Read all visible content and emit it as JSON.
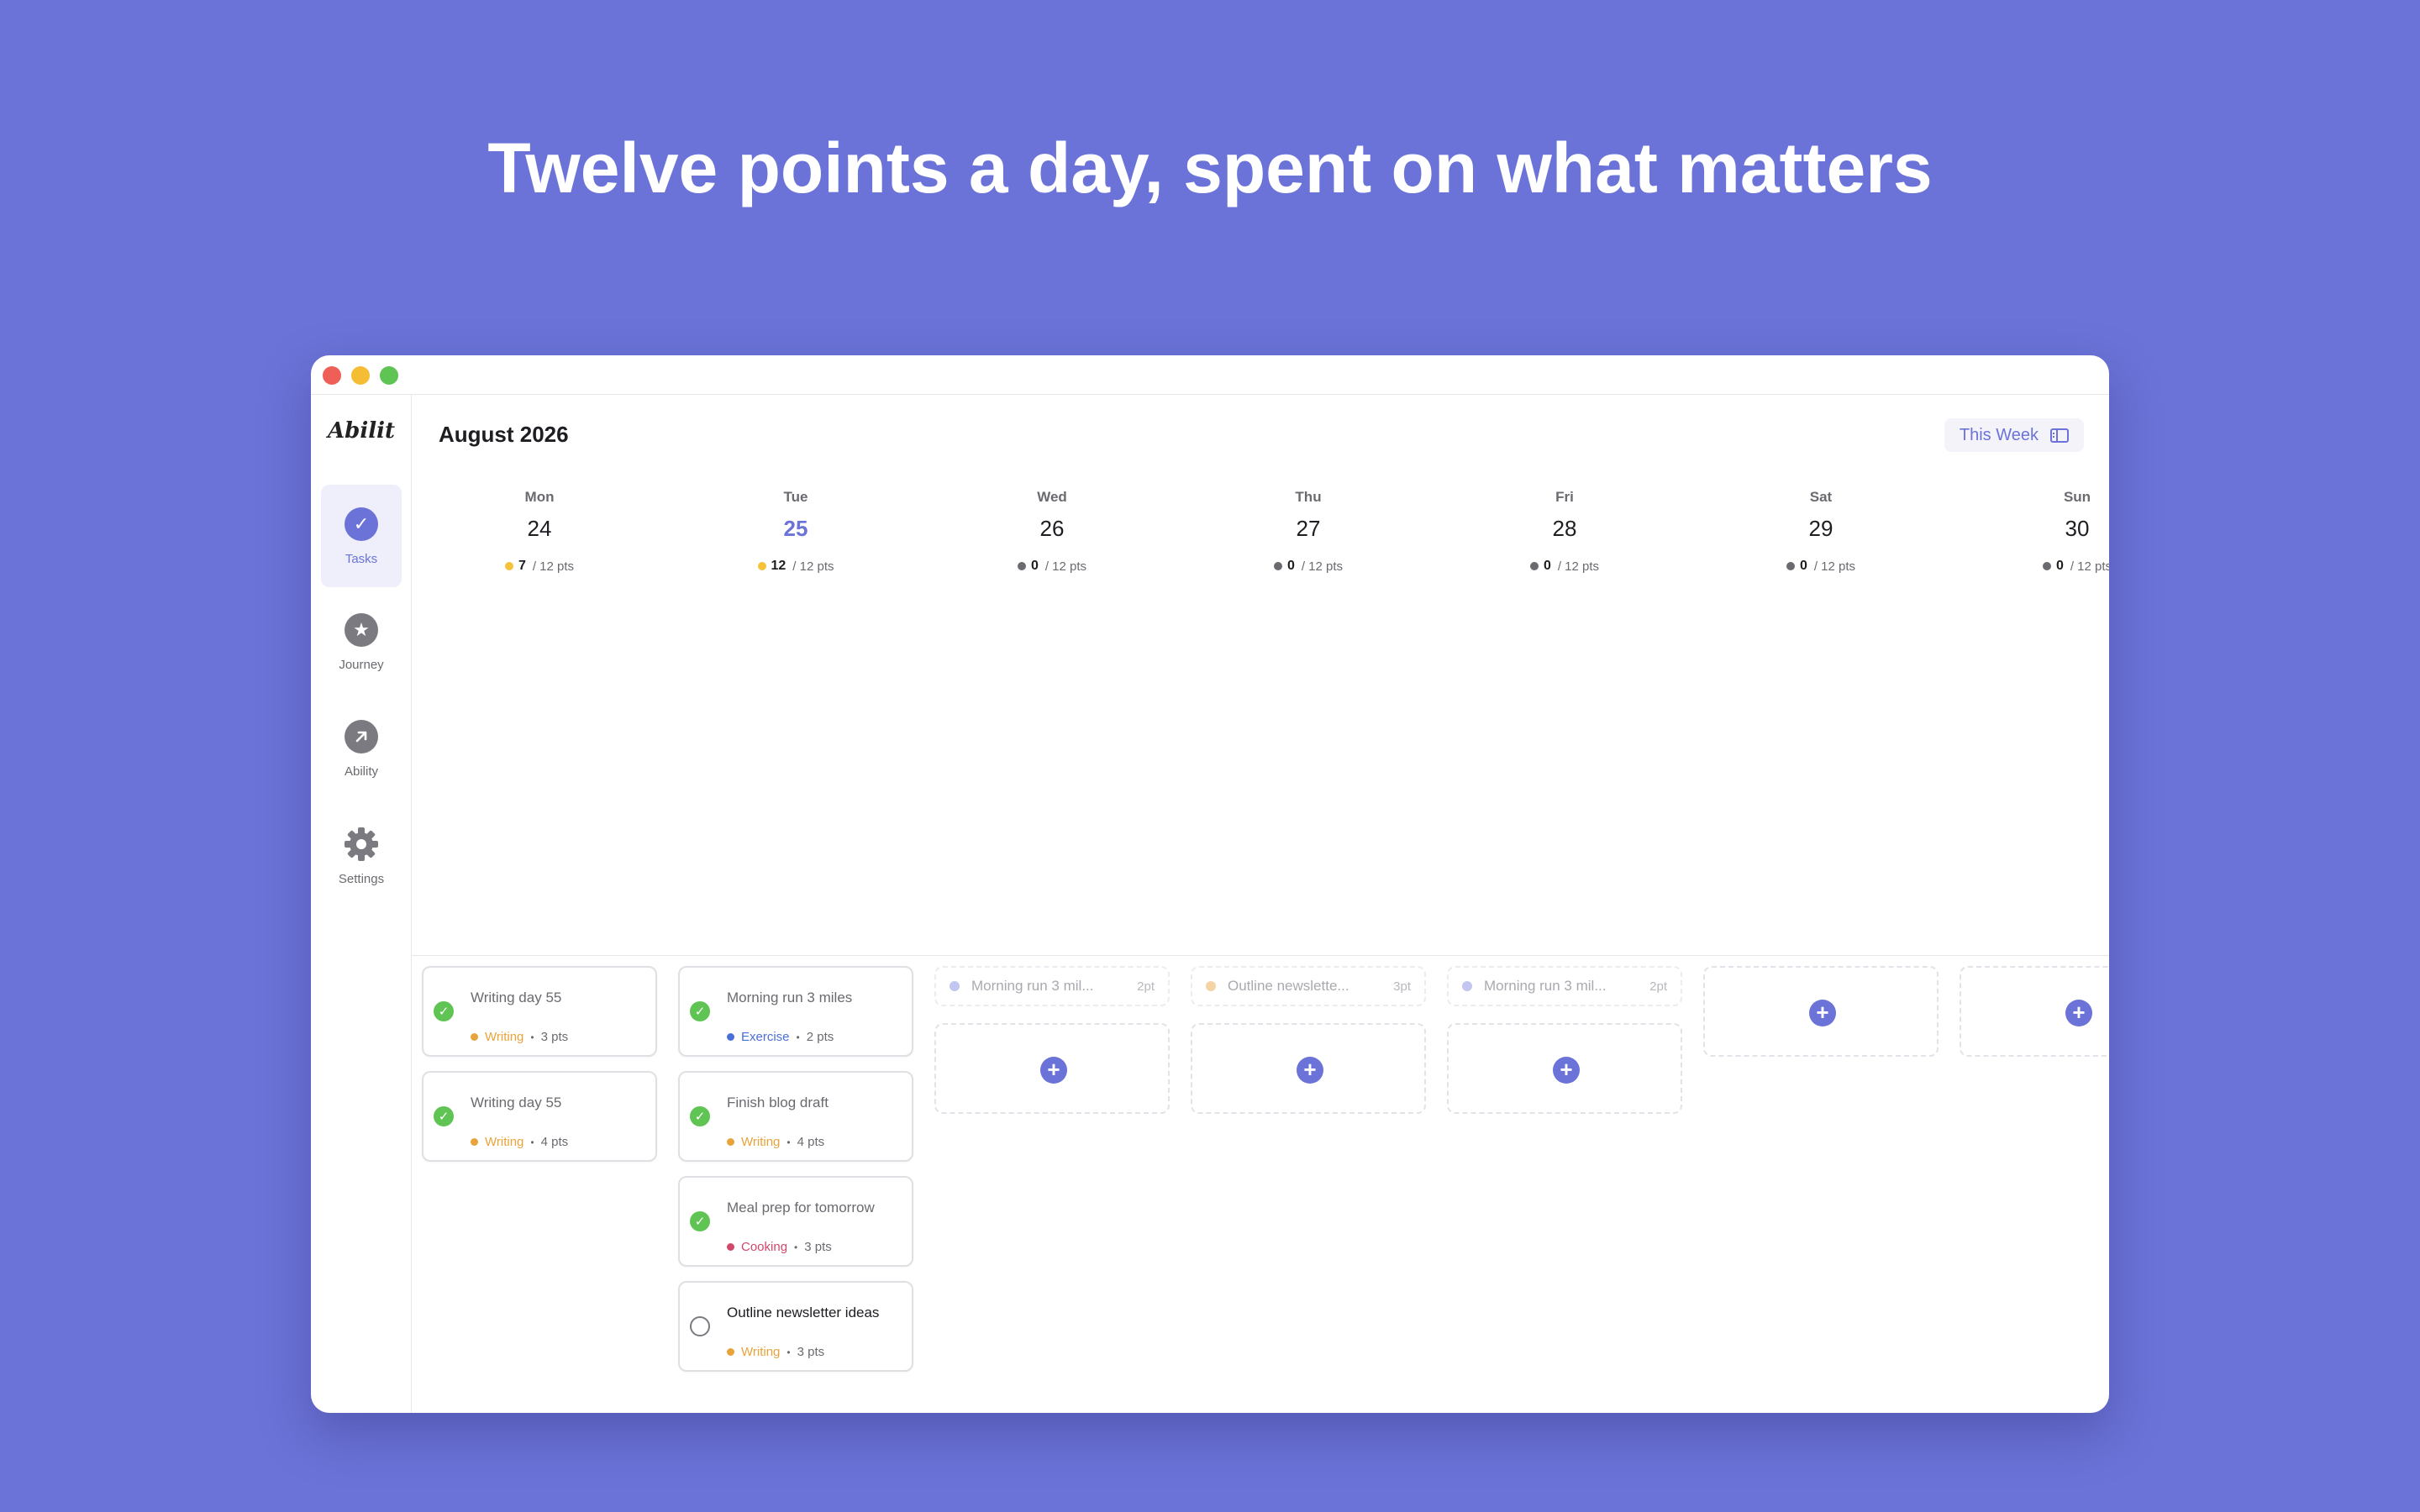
{
  "headline": "Twelve points a day, spent on what matters",
  "app": {
    "logo": "Abilit"
  },
  "sidebar": {
    "items": [
      {
        "label": "Tasks",
        "icon": "check-circle-icon"
      },
      {
        "label": "Journey",
        "icon": "star-icon"
      },
      {
        "label": "Ability",
        "icon": "arrow-up-right-icon"
      },
      {
        "label": "Settings",
        "icon": "gear-icon"
      }
    ]
  },
  "header": {
    "month": "August 2026",
    "week_button": "This Week"
  },
  "days": [
    {
      "dow": "Mon",
      "date": "24",
      "used": "7",
      "total": "/ 12 pts",
      "dot": "#f5c23a"
    },
    {
      "dow": "Tue",
      "date": "25",
      "used": "12",
      "total": "/ 12 pts",
      "dot": "#f5c23a",
      "today": true
    },
    {
      "dow": "Wed",
      "date": "26",
      "used": "0",
      "total": "/ 12 pts",
      "dot": "#6a6a70"
    },
    {
      "dow": "Thu",
      "date": "27",
      "used": "0",
      "total": "/ 12 pts",
      "dot": "#6a6a70"
    },
    {
      "dow": "Fri",
      "date": "28",
      "used": "0",
      "total": "/ 12 pts",
      "dot": "#6a6a70"
    },
    {
      "dow": "Sat",
      "date": "29",
      "used": "0",
      "total": "/ 12 pts",
      "dot": "#6a6a70"
    },
    {
      "dow": "Sun",
      "date": "30",
      "used": "0",
      "total": "/ 12 pts",
      "dot": "#6a6a70"
    }
  ],
  "tasks": {
    "mon": [
      {
        "title": "Writing day 55",
        "category": "Writing",
        "points": "3 pts",
        "done": true
      },
      {
        "title": "Writing day 55",
        "category": "Writing",
        "points": "4 pts",
        "done": true
      }
    ],
    "tue": [
      {
        "title": "Morning run 3 miles",
        "category": "Exercise",
        "points": "2 pts",
        "done": true
      },
      {
        "title": "Finish blog draft",
        "category": "Writing",
        "points": "4 pts",
        "done": true
      },
      {
        "title": "Meal prep for tomorrow",
        "category": "Cooking",
        "points": "3 pts",
        "done": true
      },
      {
        "title": "Outline newsletter ideas",
        "category": "Writing",
        "points": "3 pts",
        "done": false
      }
    ]
  },
  "ghost_tasks": {
    "wed": {
      "title": "Morning run 3 mil...",
      "points": "2pt"
    },
    "thu": {
      "title": "Outline newslette...",
      "points": "3pt"
    },
    "fri": {
      "title": "Morning run 3 mil...",
      "points": "2pt"
    }
  },
  "add_label": "+",
  "colors": {
    "accent": "#6b73d8",
    "writing": "#e8a33a",
    "exercise": "#4a6fd8",
    "cooking": "#d2486a",
    "done": "#5fc454"
  }
}
